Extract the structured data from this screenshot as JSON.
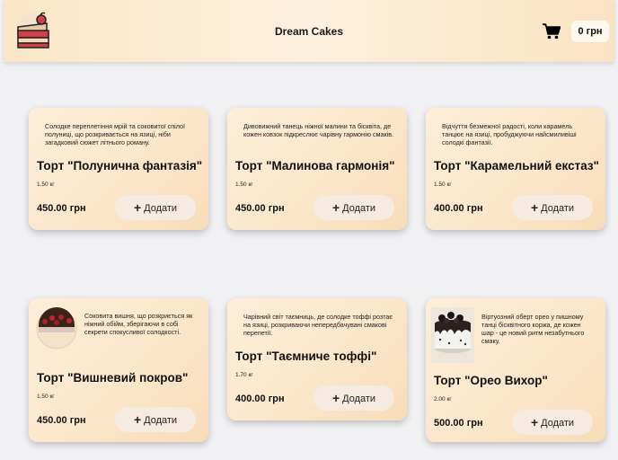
{
  "header": {
    "brand": "Dream Cakes",
    "cart_icon": "shopping-cart-icon",
    "logo": "cake-slice-logo",
    "balance": "0 грн"
  },
  "add_label": "Додати",
  "products": [
    {
      "description": "Солодке переплетіння мрій та соковитої спілої полуниці, що розкривається на язиці, ніби загадковий сюжет літнього роману.",
      "name": "Торт \"Полунична фантазія\"",
      "weight": "1.50 кг",
      "price": "450.00 грн"
    },
    {
      "description": "Дивовижний танець ніжної малини та бісквіта, де кожен ковзок підкреслює чарівну гармонію смаків.",
      "name": "Торт \"Малинова гармонія\"",
      "weight": "1.50 кг",
      "price": "450.00 грн"
    },
    {
      "description": "Відчуття безмежної радості, коли карамель танцює на язиці, пробуджуючи найсмиливіші солодкі фантазії.",
      "name": "Торт \"Карамельний екстаз\"",
      "weight": "1.50 кг",
      "price": "400.00 грн"
    },
    {
      "description": "Соковита вишня, що розкриється як ніжний обійм, зберігаючи в собі секрети спокусливої солодкості.",
      "name": "Торт \"Вишневий покров\"",
      "weight": "1.50 кг",
      "price": "450.00 грн",
      "image": "cherry-cake-image"
    },
    {
      "description": "Чарівний світ таємниць, де солодке тоффі розтає на язиці, розкриваючи непередбачувані смакові перепетії.",
      "name": "Торт \"Таємниче тоффі\"",
      "weight": "1.70 кг",
      "price": "400.00 грн"
    },
    {
      "description": "Віртуозний оберт орео у пишному танці бісквітного коржа, де кожен шар - це новий ритм незабутнього смаку.",
      "name": "Торт \"Орео Вихор\"",
      "weight": "2.00 кг",
      "price": "500.00 грн",
      "image": "oreo-cake-image"
    }
  ]
}
